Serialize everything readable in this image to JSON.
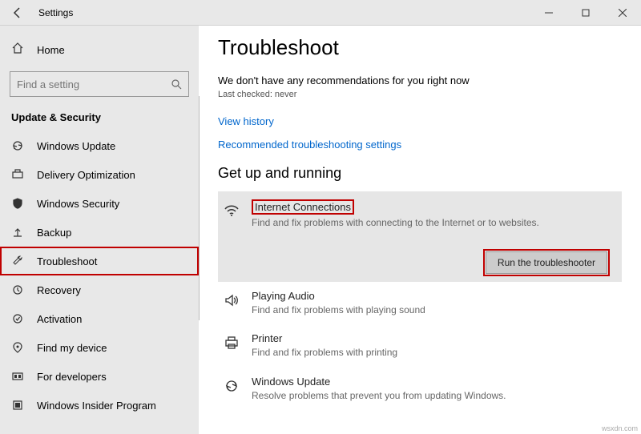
{
  "window": {
    "title": "Settings"
  },
  "sidebar": {
    "home": "Home",
    "search_placeholder": "Find a setting",
    "category": "Update & Security",
    "items": [
      {
        "label": "Windows Update",
        "icon": "sync"
      },
      {
        "label": "Delivery Optimization",
        "icon": "delivery"
      },
      {
        "label": "Windows Security",
        "icon": "shield"
      },
      {
        "label": "Backup",
        "icon": "backup"
      },
      {
        "label": "Troubleshoot",
        "icon": "wrench"
      },
      {
        "label": "Recovery",
        "icon": "recovery"
      },
      {
        "label": "Activation",
        "icon": "activation"
      },
      {
        "label": "Find my device",
        "icon": "location"
      },
      {
        "label": "For developers",
        "icon": "developer"
      },
      {
        "label": "Windows Insider Program",
        "icon": "insider"
      }
    ]
  },
  "content": {
    "title": "Troubleshoot",
    "recommendation": "We don't have any recommendations for you right now",
    "last_checked": "Last checked: never",
    "view_history": "View history",
    "recommended_settings": "Recommended troubleshooting settings",
    "section_heading": "Get up and running",
    "run_label": "Run the troubleshooter",
    "items": [
      {
        "title": "Internet Connections",
        "desc": "Find and fix problems with connecting to the Internet or to websites."
      },
      {
        "title": "Playing Audio",
        "desc": "Find and fix problems with playing sound"
      },
      {
        "title": "Printer",
        "desc": "Find and fix problems with printing"
      },
      {
        "title": "Windows Update",
        "desc": "Resolve problems that prevent you from updating Windows."
      }
    ]
  },
  "watermark": "wsxdn.com"
}
